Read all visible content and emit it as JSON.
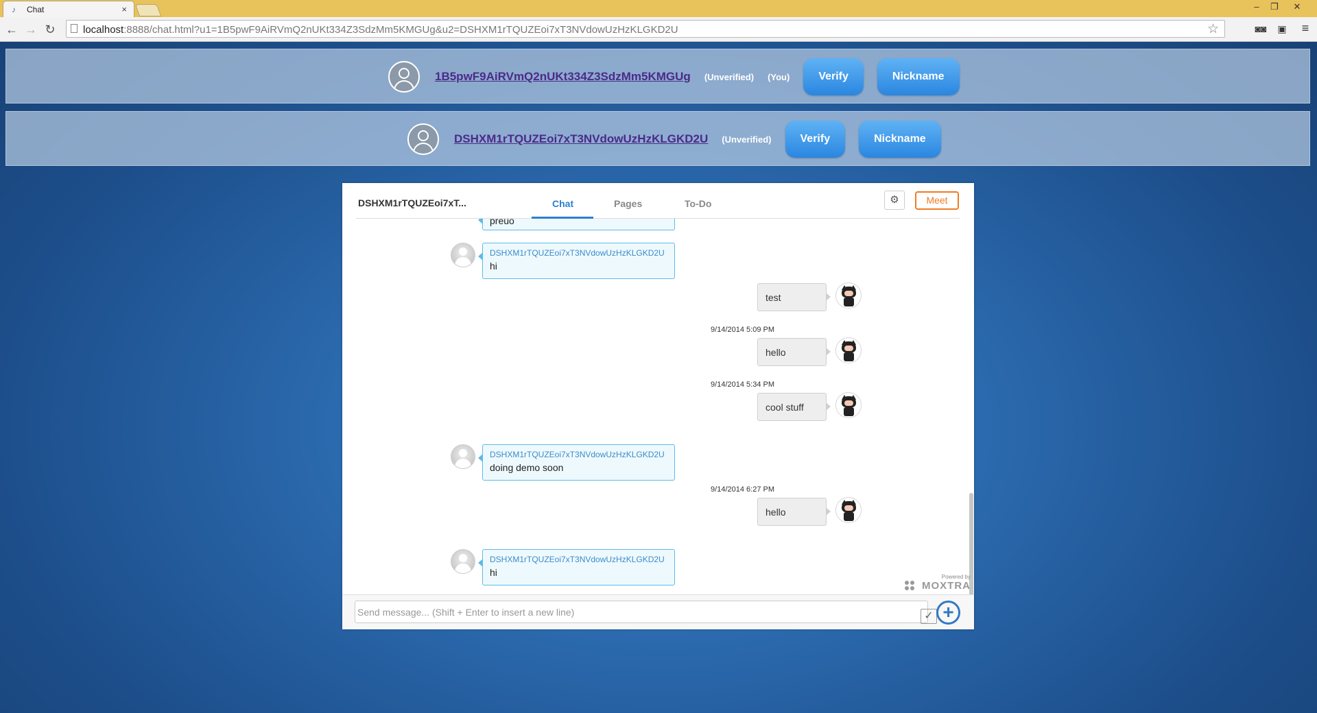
{
  "browser": {
    "tab_title": "Chat",
    "tab_close": "×",
    "url_host": "localhost",
    "url_rest": ":8888/chat.html?u1=1B5pwF9AiRVmQ2nUKt334Z3SdzMm5KMGUg&u2=DSHXM1rTQUZEoi7xT3NVdowUzHzKLGKD2U",
    "window_controls": [
      "–",
      "❐",
      "✕"
    ]
  },
  "identities": [
    {
      "id": "1B5pwF9AiRVmQ2nUKt334Z3SdzMm5KMGUg",
      "status": "(Unverified)",
      "you": "(You)",
      "verify_label": "Verify",
      "nickname_label": "Nickname"
    },
    {
      "id": "DSHXM1rTQUZEoi7xT3NVdowUzHzKLGKD2U",
      "status": "(Unverified)",
      "verify_label": "Verify",
      "nickname_label": "Nickname"
    }
  ],
  "chat": {
    "title": "DSHXM1rTQUZEoi7xT...",
    "tabs": [
      "Chat",
      "Pages",
      "To-Do"
    ],
    "active_tab": "Chat",
    "meet_label": "Meet",
    "partial_text": "preuo",
    "messages": [
      {
        "dir": "in",
        "sender": "DSHXM1rTQUZEoi7xT3NVdowUzHzKLGKD2U",
        "text": "hi"
      },
      {
        "dir": "out",
        "text": "test"
      },
      {
        "dir": "ts",
        "text": "9/14/2014 5:09 PM"
      },
      {
        "dir": "out",
        "text": "hello"
      },
      {
        "dir": "ts",
        "text": "9/14/2014 5:34 PM"
      },
      {
        "dir": "out",
        "text": "cool stuff"
      },
      {
        "dir": "in",
        "sender": "DSHXM1rTQUZEoi7xT3NVdowUzHzKLGKD2U",
        "text": "doing demo soon"
      },
      {
        "dir": "ts",
        "text": "9/14/2014 6:27 PM"
      },
      {
        "dir": "out",
        "text": "hello"
      },
      {
        "dir": "in",
        "sender": "DSHXM1rTQUZEoi7xT3NVdowUzHzKLGKD2U",
        "text": "hi"
      }
    ],
    "powered_by": "Powered by",
    "brand": "MOXTRA",
    "input_placeholder": "Send message... (Shift + Enter to insert a new line)"
  }
}
